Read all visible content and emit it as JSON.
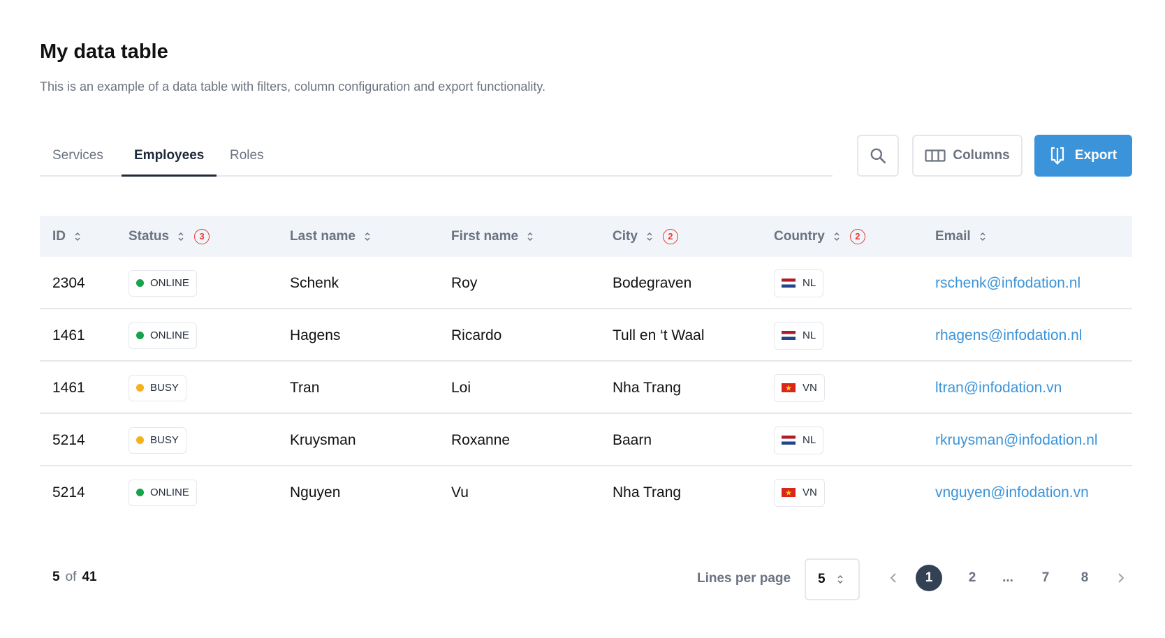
{
  "header": {
    "title": "My data table",
    "subtitle": "This is an example of a data table with filters, column configuration and export functionality."
  },
  "tabs": [
    {
      "label": "Services",
      "active": false
    },
    {
      "label": "Employees",
      "active": true
    },
    {
      "label": "Roles",
      "active": false
    }
  ],
  "toolbar": {
    "search_icon": "search-icon",
    "columns_label": "Columns",
    "export_label": "Export",
    "accent_color": "#3b94d9"
  },
  "table": {
    "columns": [
      {
        "label": "ID",
        "filter_count": null
      },
      {
        "label": "Status",
        "filter_count": "3"
      },
      {
        "label": "Last name",
        "filter_count": null
      },
      {
        "label": "First name",
        "filter_count": null
      },
      {
        "label": "City",
        "filter_count": "2"
      },
      {
        "label": "Country",
        "filter_count": "2"
      },
      {
        "label": "Email",
        "filter_count": null
      }
    ],
    "rows": [
      {
        "id": "2304",
        "status": "ONLINE",
        "status_color": "#16a34a",
        "last_name": "Schenk",
        "first_name": "Roy",
        "city": "Bodegraven",
        "country": "NL",
        "email": "rschenk@infodation.nl"
      },
      {
        "id": "1461",
        "status": "ONLINE",
        "status_color": "#16a34a",
        "last_name": "Hagens",
        "first_name": "Ricardo",
        "city": "Tull en ‘t Waal",
        "country": "NL",
        "email": "rhagens@infodation.nl"
      },
      {
        "id": "1461",
        "status": "BUSY",
        "status_color": "#f5b01a",
        "last_name": "Tran",
        "first_name": "Loi",
        "city": "Nha Trang",
        "country": "VN",
        "email": "ltran@infodation.vn"
      },
      {
        "id": "5214",
        "status": "BUSY",
        "status_color": "#f5b01a",
        "last_name": "Kruysman",
        "first_name": "Roxanne",
        "city": "Baarn",
        "country": "NL",
        "email": "rkruysman@infodation.nl"
      },
      {
        "id": "5214",
        "status": "ONLINE",
        "status_color": "#16a34a",
        "last_name": "Nguyen",
        "first_name": "Vu",
        "city": "Nha Trang",
        "country": "VN",
        "email": "vnguyen@infodation.vn"
      }
    ]
  },
  "footer": {
    "shown": "5",
    "of_label": "of",
    "total": "41",
    "lines_per_page_label": "Lines per page",
    "lines_per_page_value": "5",
    "pages": [
      "1",
      "2",
      "...",
      "7",
      "8"
    ],
    "current_page": "1"
  }
}
